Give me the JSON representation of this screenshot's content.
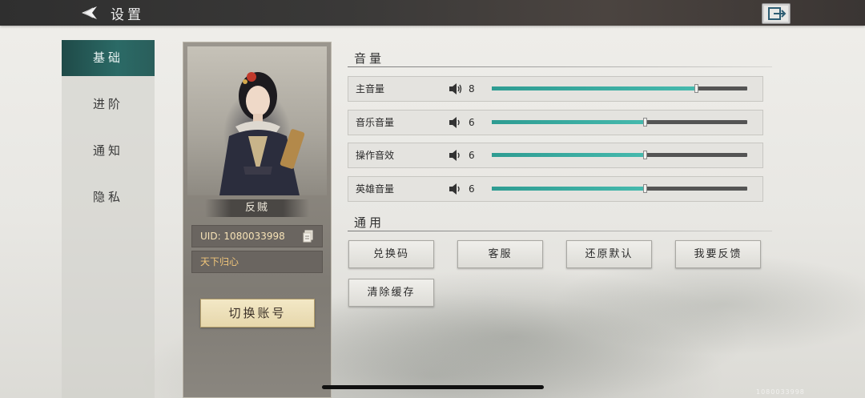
{
  "header": {
    "title": "设置"
  },
  "nav": {
    "items": [
      {
        "label": "基础"
      },
      {
        "label": "进阶"
      },
      {
        "label": "通知"
      },
      {
        "label": "隐私"
      }
    ]
  },
  "profile": {
    "role": "反贼",
    "uid": "UID: 1080033998",
    "motto": "天下归心",
    "switch_label": "切换账号"
  },
  "volume": {
    "title": "音量",
    "rows": [
      {
        "label": "主音量",
        "value": "8",
        "level": 0.8
      },
      {
        "label": "音乐音量",
        "value": "6",
        "level": 0.6
      },
      {
        "label": "操作音效",
        "value": "6",
        "level": 0.6
      },
      {
        "label": "英雄音量",
        "value": "6",
        "level": 0.6
      }
    ]
  },
  "general": {
    "title": "通用",
    "buttons": [
      {
        "label": "兑换码"
      },
      {
        "label": "客服"
      },
      {
        "label": "还原默认"
      },
      {
        "label": "我要反馈"
      },
      {
        "label": "清除缓存"
      }
    ]
  },
  "colors": {
    "accent": "#2b6a66",
    "slider_fill": "#3fb0a5",
    "gold_button": "#e9dcb4"
  },
  "icons": [
    "back-arrow-icon",
    "exit-icon",
    "copy-icon",
    "speaker-icon"
  ],
  "watermark": "1080033998"
}
